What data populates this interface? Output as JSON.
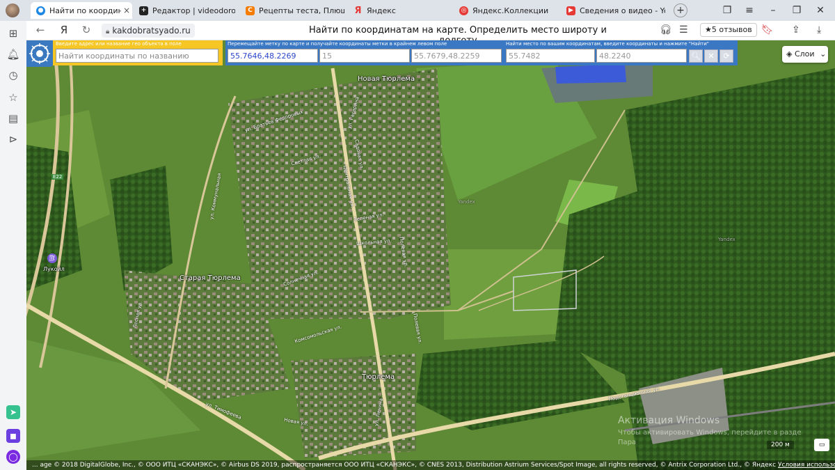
{
  "tabs": [
    {
      "title": "Найти по координатам",
      "active": true,
      "favicon_color": "#1e88e5",
      "icon": "globe-icon"
    },
    {
      "title": "Редактор | videodorogros",
      "active": false,
      "favicon_color": "#222222",
      "icon": "plus-square-icon"
    },
    {
      "title": "Рецепты теста, Плюшка к",
      "active": false,
      "favicon_color": "#f57c00",
      "icon": "recipe-icon"
    },
    {
      "title": "Яндекс",
      "active": false,
      "favicon_color": "#e53935",
      "icon": "yandex-icon"
    },
    {
      "title": "Яндекс.Коллекции",
      "active": false,
      "favicon_color": "#e53935",
      "icon": "collections-icon"
    },
    {
      "title": "Сведения о видео - YouT",
      "active": false,
      "favicon_color": "#e53935",
      "icon": "youtube-icon"
    }
  ],
  "addressbar": {
    "url": "kakdobratsyado.ru",
    "page_title": "Найти по координатам на карте. Определить место широту и долготу",
    "reviews": "★5 отзывов"
  },
  "map_ui": {
    "search_hint": "Введите адрес или название гео объекта в поле",
    "search_placeholder": "Найти координаты по названию",
    "coords_hint": "Перемещайте метку по карте и получайте координаты метки в крайнем левом поле",
    "coords_value": "55.7646,48.2269",
    "zoom_value": "15",
    "center_value": "55.7679,48.2259",
    "find_hint": "Найти место по вашим координатам, введите координаты и нажмите \"Найти\"",
    "lat_value": "55.7482",
    "lon_value": "48.2240",
    "layers_label": "Слои",
    "scale_label": "200 м",
    "copyright": "... age © 2018 DigitalGlobe, Inc., © ООО ИТЦ «СКАНЭКС», © Airbus DS 2019, распространяется ООО ИТЦ «СКАНЭКС», © CNES 2013, Distribution Astrium Services/Spot Image, all rights reserved, © Antrix Corporation Ltd., © Яндекс",
    "terms_link": "Условия использования",
    "watermark": "Активация Windows",
    "watermark_sub": "Чтобы активировать Windows, перейдите в разде",
    "watermark_sub2": "Пара"
  },
  "map_labels": {
    "village_new": "Новая Тюрлема",
    "village_old": "Старая Тюрлема",
    "village_main": "Тюрлема",
    "lukoil": "Лукойл",
    "highway": "E22",
    "yandex1": "Yandex",
    "yandex2": "Yandex"
  },
  "streets": {
    "s1": "ул. Братьев Федоровых",
    "s2": "Светлая ул.",
    "s3": "ул. Коммунальная",
    "s4": "Центральная ул.",
    "s5": "ул. Гагарина",
    "s6": "Зеленая ул.",
    "s7": "Школьная ул.",
    "s8": "Садовая ул.",
    "s9": "Полевая ул.",
    "s10": "Солнечная ул.",
    "s11": "Комсомольская ул.",
    "s12": "Подстанционная ул.",
    "s13": "ул. Тимофеева",
    "s14": "Новая ул.",
    "s15": "Полевая ул.",
    "s16": "ул. Ленина",
    "s17": "Лесная ул."
  }
}
